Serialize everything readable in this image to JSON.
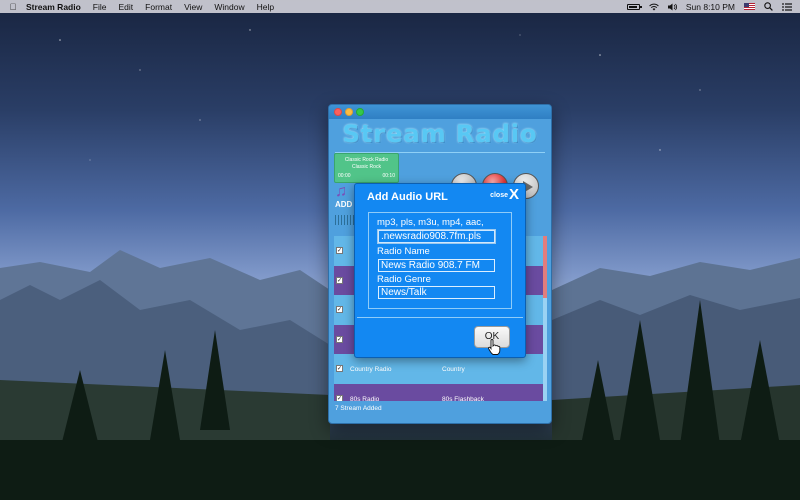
{
  "menubar": {
    "app_name": "Stream Radio",
    "menus": [
      "File",
      "Edit",
      "Format",
      "View",
      "Window",
      "Help"
    ],
    "clock": "Sun 8:10 PM",
    "battery_level": 0.85
  },
  "window": {
    "app_title": "Stream Radio",
    "now_playing": {
      "station": "Classic Rock Radio",
      "genre": "Classic Rock",
      "elapsed": "00:00",
      "duration": "00:10"
    },
    "add_logo_text": "ADD",
    "stations": [
      {
        "name": "",
        "genre": "",
        "checked": true,
        "style": "light"
      },
      {
        "name": "",
        "genre": "",
        "checked": true,
        "style": "purple"
      },
      {
        "name": "",
        "genre": "",
        "checked": true,
        "style": "light"
      },
      {
        "name": "",
        "genre": "",
        "checked": true,
        "style": "purple"
      },
      {
        "name": "Country Radio",
        "genre": "Country",
        "checked": true,
        "style": "light"
      },
      {
        "name": "80s Radio",
        "genre": "80s Flashback",
        "checked": true,
        "style": "purple"
      }
    ],
    "status": "7 Stream Added"
  },
  "dialog": {
    "title": "Add Audio URL",
    "close_label": "close",
    "close_glyph": "X",
    "formats_label": "mp3, pls, m3u, mp4, aac,",
    "url_value": ".newsradio908.7fm.pls",
    "name_label": "Radio Name",
    "name_value": "News Radio 908.7 FM",
    "genre_label": "Radio Genre",
    "genre_value": "News/Talk",
    "ok_label": "OK"
  },
  "colors": {
    "window_bg": "#4fa0de",
    "dialog_bg": "#1388f2",
    "row_light": "#62b7e8",
    "row_purple": "#6a4ba0",
    "now_playing_bg": "#51c489"
  }
}
